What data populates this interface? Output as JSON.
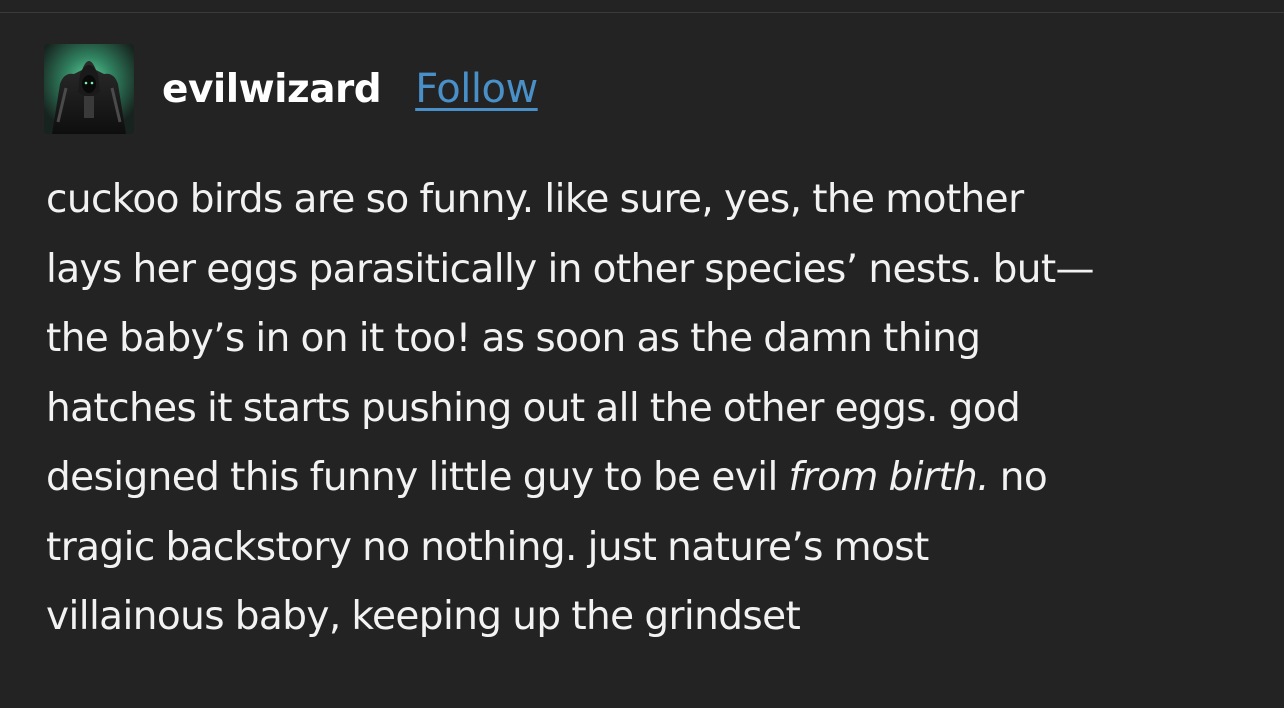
{
  "post": {
    "author": "evilwizard",
    "follow_label": "Follow",
    "lines": {
      "l1": "cuckoo birds are so funny. like sure, yes, the mother",
      "l2": "lays her eggs parasitically in other species’ nests. but—",
      "l3": "the baby’s in on it too! as soon as the damn thing",
      "l4": "hatches it starts pushing out all the other eggs. god",
      "l5_before": "designed this funny little guy to be evil ",
      "l5_em": "from birth.",
      "l5_after": " no",
      "l6": "tragic backstory no nothing. just nature’s most",
      "l7": "villainous baby, keeping up the grindset"
    }
  },
  "colors": {
    "background": "#232323",
    "text": "#f2f2f2",
    "link": "#4a90c8"
  },
  "icons": {
    "avatar": "hooded-wizard-avatar"
  }
}
